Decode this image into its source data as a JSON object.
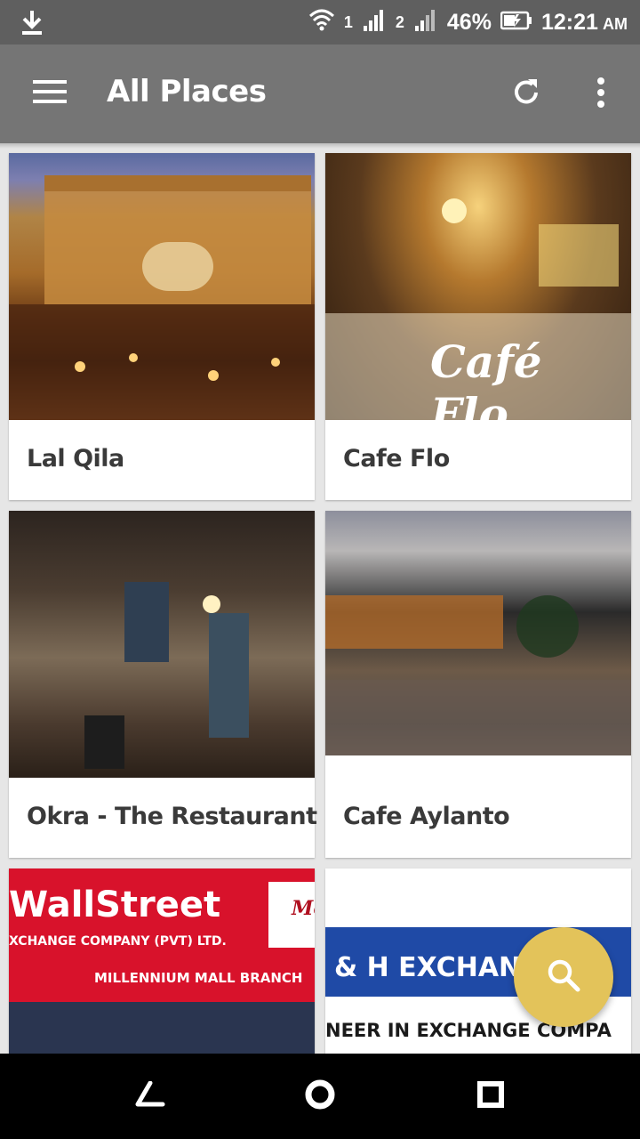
{
  "status_bar": {
    "battery": "46%",
    "time": "12:21",
    "ampm": "AM",
    "sim1": "1",
    "sim2": "2",
    "icons": [
      "download-icon",
      "wifi-icon",
      "signal-icon",
      "battery-icon"
    ]
  },
  "app_bar": {
    "title": "All Places",
    "icons": [
      "menu-icon",
      "refresh-icon",
      "more-vert-icon"
    ]
  },
  "places": [
    {
      "name": "Lal Qila"
    },
    {
      "name": "Cafe Flo"
    },
    {
      "name": "Okra - The Restaurant"
    },
    {
      "name": "Cafe Aylanto"
    },
    {
      "name": ""
    },
    {
      "name": ""
    }
  ],
  "image_text": {
    "cafe_flo_sign": "Café Flo",
    "wallstreet_logo": "WallStreet",
    "wallstreet_sub": "XCHANGE COMPANY (PVT) LTD.",
    "wallstreet_branch": "MILLENNIUM MALL BRANCH",
    "wallstreet_side": "Mo",
    "hexchange_title": "& H EXCHANGE CO",
    "hexchange_sub": "NEER IN EXCHANGE COMPA"
  },
  "fab": {
    "icon": "search-icon"
  },
  "nav_bar": {
    "icons": [
      "back-icon",
      "home-icon",
      "recents-icon"
    ]
  },
  "colors": {
    "status_bar": "#5f5f5f",
    "app_bar": "#757575",
    "fab": "#e3c35a",
    "background": "#e6e6e6",
    "nav_bar": "#000000"
  }
}
